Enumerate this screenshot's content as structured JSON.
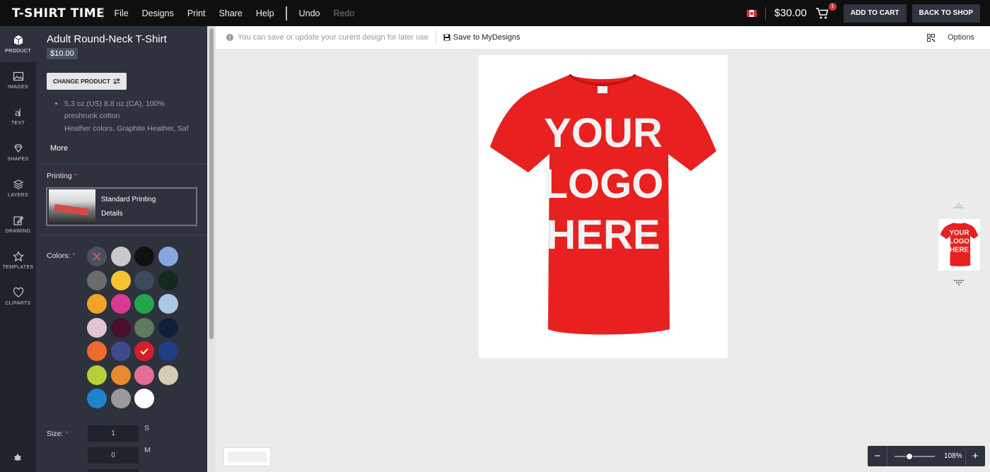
{
  "header": {
    "logo": "T-SHIRT TIME",
    "menu": [
      "File",
      "Designs",
      "Print",
      "Share",
      "Help"
    ],
    "undo": "Undo",
    "redo": "Redo",
    "price": "$30.00",
    "cart_count": "1",
    "add_to_cart": "ADD TO CART",
    "back_to_shop": "BACK TO SHOP"
  },
  "rail": {
    "items": [
      "PRODUCT",
      "IMAGES",
      "TEXT",
      "SHAPES",
      "LAYERS",
      "DRAWING",
      "TEMPLATES",
      "CLIPARTS"
    ]
  },
  "product": {
    "title": "Adult Round-Neck T-Shirt",
    "price": "$10.00",
    "change_label": "CHANGE PRODUCT",
    "description": [
      "5.3 oz.(US) 8.8 oz.(CA), 100% preshrunk cotton",
      "Heather colors, Graphite Heather, Saf"
    ],
    "more": "More"
  },
  "printing": {
    "label": "Printing",
    "option": "Standard Printing",
    "details": "Details"
  },
  "colors": {
    "label": "Colors:",
    "swatches": [
      "none",
      "#c9c9c9",
      "#111111",
      "#86a8dc",
      "#6b6b6b",
      "#f3c530",
      "#3d4a5c",
      "#14291c",
      "#f2a42a",
      "#d83a8f",
      "#22a64a",
      "#a8c8e6",
      "#e2c4d4",
      "#4a0f2c",
      "#5f7a5e",
      "#0f1e3a",
      "#ef6a2e",
      "#3e4a8c",
      "#d21f2b",
      "#1e3f85",
      "#b7cf3a",
      "#e88a2e",
      "#e46e96",
      "#d7cbb3",
      "#1e82cc",
      "#9a9a9a",
      "#ffffff"
    ],
    "selected_index": 18
  },
  "size": {
    "label": "Size:",
    "rows": [
      {
        "qty": "1",
        "size": "S"
      },
      {
        "qty": "0",
        "size": "M"
      }
    ]
  },
  "toolbar": {
    "info": "You can save or update your curent design for later use",
    "save": "Save to MyDesigns",
    "options": "Options"
  },
  "design": {
    "shirt_color": "#e8201f",
    "text_lines": [
      "YOUR",
      "LOGO",
      "HERE"
    ]
  },
  "zoom": {
    "minus": "−",
    "plus": "+",
    "value": "108%"
  }
}
